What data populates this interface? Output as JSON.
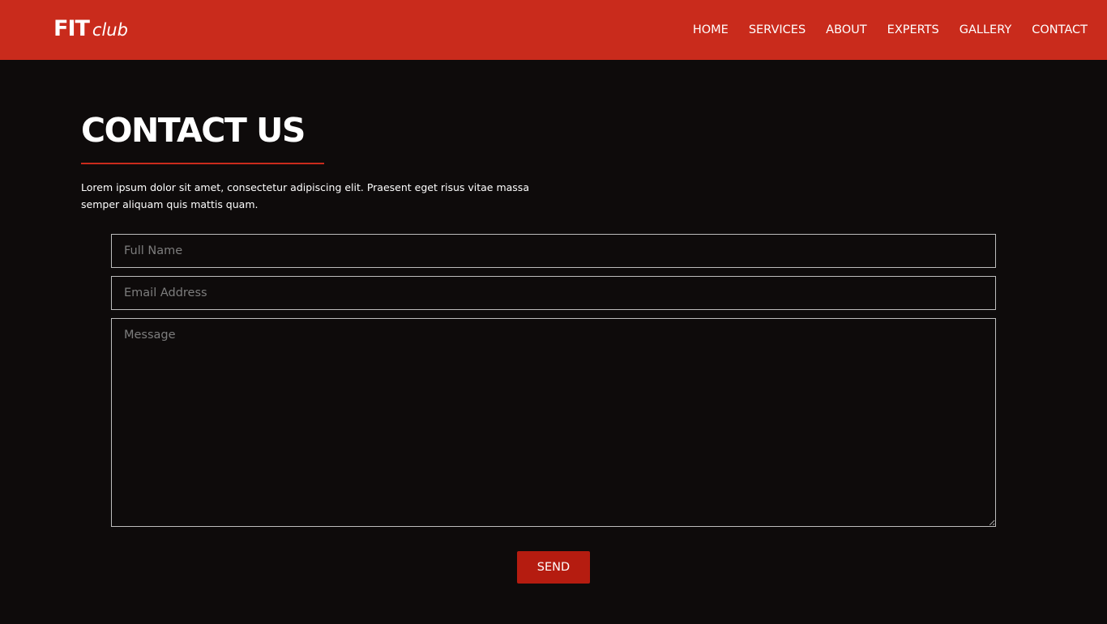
{
  "brand": {
    "logo_main": "FIT",
    "logo_sub": "club"
  },
  "nav": {
    "items": [
      {
        "label": "HOME"
      },
      {
        "label": "SERVICES"
      },
      {
        "label": "ABOUT"
      },
      {
        "label": "EXPERTS"
      },
      {
        "label": "GALLERY"
      },
      {
        "label": "CONTACT"
      }
    ]
  },
  "contact": {
    "title": "CONTACT US",
    "intro": "Lorem ipsum dolor sit amet, consectetur adipiscing elit. Praesent eget risus vitae massa semper aliquam quis mattis quam."
  },
  "form": {
    "name_placeholder": "Full Name",
    "email_placeholder": "Email Address",
    "message_placeholder": "Message",
    "send_label": "SEND"
  },
  "colors": {
    "accent": "#c92b1c",
    "button": "#b51c10",
    "background": "#0e0b0b",
    "text": "#ffffff"
  }
}
